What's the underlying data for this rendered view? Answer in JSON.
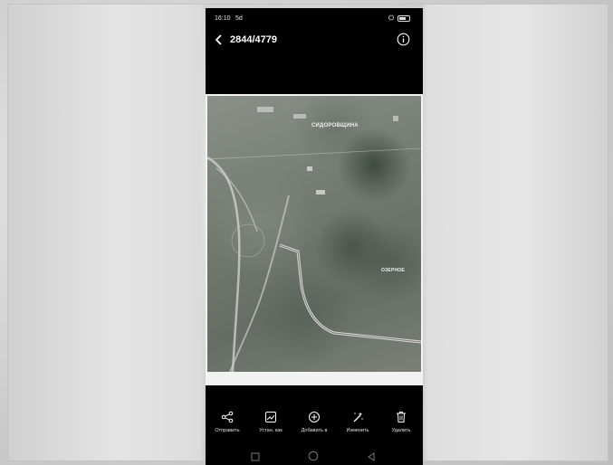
{
  "status_bar": {
    "time": "16:10",
    "signal": "5d"
  },
  "header": {
    "counter": "2844/4779",
    "back_icon": "chevron-left-icon",
    "info_icon": "info-icon"
  },
  "photo": {
    "map_labels": [
      "СИДОРОВЩИНА",
      "ОЗЕРНОЕ"
    ]
  },
  "actions": [
    {
      "label": "Отправить",
      "icon": "share-icon"
    },
    {
      "label": "Устан. как",
      "icon": "set-as-icon"
    },
    {
      "label": "Добавить в",
      "icon": "add-to-icon"
    },
    {
      "label": "Изменить",
      "icon": "edit-wand-icon"
    },
    {
      "label": "Удалить",
      "icon": "trash-icon"
    }
  ],
  "nav": {
    "recent_icon": "square-icon",
    "home_icon": "circle-icon",
    "back_icon": "triangle-back-icon"
  },
  "colors": {
    "phone_bg": "#000000",
    "text": "#ffffff",
    "page_bg": "#d9d9d9"
  }
}
